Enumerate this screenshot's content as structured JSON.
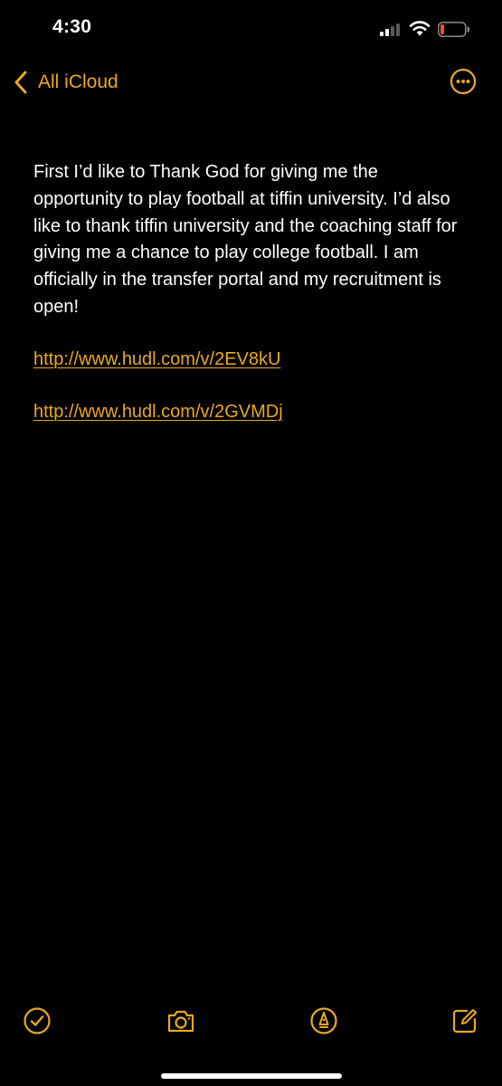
{
  "status_bar": {
    "time": "4:30"
  },
  "nav": {
    "back_label": "All iCloud",
    "back_icon": "chevron-left-icon",
    "more_icon": "ellipsis-circle-icon"
  },
  "note": {
    "paragraph": "First I’d like to Thank God for giving me the opportunity to play football at tiffin university. I’d also like to thank tiffin university and the coaching staff for giving me a chance to play college football. I am officially in the transfer portal and my recruitment is open!",
    "links": [
      "http://www.hudl.com/v/2EV8kU",
      "http://www.hudl.com/v/2GVMDj"
    ]
  },
  "toolbar": {
    "icons": [
      "checklist-icon",
      "camera-icon",
      "markup-icon",
      "compose-icon"
    ]
  },
  "colors": {
    "accent": "#e9a922",
    "background": "#000000",
    "text": "#ffffff",
    "battery_low": "#eb4d3d"
  }
}
